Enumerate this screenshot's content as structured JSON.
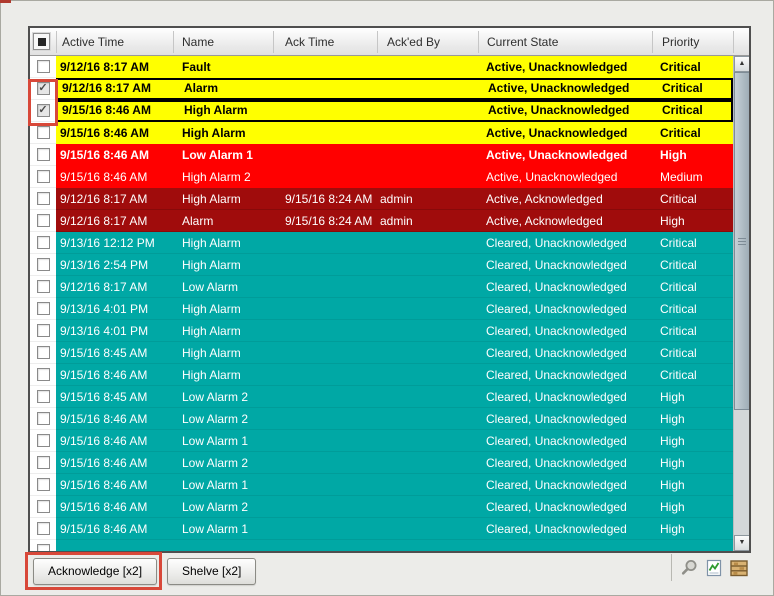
{
  "table": {
    "columns": [
      "Active Time",
      "Name",
      "Ack Time",
      "Ack'ed By",
      "Current State",
      "Priority"
    ],
    "rows": [
      {
        "active_time": "9/12/16 8:17 AM",
        "name": "Fault",
        "ack_time": "",
        "acked_by": "",
        "current_state": "Active, Unacknowledged",
        "priority": "Critical",
        "style": "yellow",
        "bold": true,
        "checked": false,
        "selected": false
      },
      {
        "active_time": "9/12/16 8:17 AM",
        "name": "Alarm",
        "ack_time": "",
        "acked_by": "",
        "current_state": "Active, Unacknowledged",
        "priority": "Critical",
        "style": "yellow",
        "bold": true,
        "checked": true,
        "selected": true
      },
      {
        "active_time": "9/15/16 8:46 AM",
        "name": "High Alarm",
        "ack_time": "",
        "acked_by": "",
        "current_state": "Active, Unacknowledged",
        "priority": "Critical",
        "style": "yellow",
        "bold": true,
        "checked": true,
        "selected": true
      },
      {
        "active_time": "9/15/16 8:46 AM",
        "name": "High Alarm",
        "ack_time": "",
        "acked_by": "",
        "current_state": "Active, Unacknowledged",
        "priority": "Critical",
        "style": "yellow",
        "bold": true,
        "checked": false,
        "selected": false
      },
      {
        "active_time": "9/15/16 8:46 AM",
        "name": "Low Alarm 1",
        "ack_time": "",
        "acked_by": "",
        "current_state": "Active, Unacknowledged",
        "priority": "High",
        "style": "red",
        "bold": true,
        "checked": false,
        "selected": false
      },
      {
        "active_time": "9/15/16 8:46 AM",
        "name": "High Alarm 2",
        "ack_time": "",
        "acked_by": "",
        "current_state": "Active, Unacknowledged",
        "priority": "Medium",
        "style": "red",
        "bold": false,
        "checked": false,
        "selected": false
      },
      {
        "active_time": "9/12/16 8:17 AM",
        "name": "High Alarm",
        "ack_time": "9/15/16 8:24 AM",
        "acked_by": "admin",
        "current_state": "Active, Acknowledged",
        "priority": "Critical",
        "style": "darkred",
        "bold": false,
        "checked": false,
        "selected": false
      },
      {
        "active_time": "9/12/16 8:17 AM",
        "name": "Alarm",
        "ack_time": "9/15/16 8:24 AM",
        "acked_by": "admin",
        "current_state": "Active, Acknowledged",
        "priority": "High",
        "style": "darkred",
        "bold": false,
        "checked": false,
        "selected": false
      },
      {
        "active_time": "9/13/16 12:12 PM",
        "name": "High Alarm",
        "ack_time": "",
        "acked_by": "",
        "current_state": "Cleared, Unacknowledged",
        "priority": "Critical",
        "style": "teal",
        "bold": false,
        "checked": false,
        "selected": false
      },
      {
        "active_time": "9/13/16 2:54 PM",
        "name": "High Alarm",
        "ack_time": "",
        "acked_by": "",
        "current_state": "Cleared, Unacknowledged",
        "priority": "Critical",
        "style": "teal",
        "bold": false,
        "checked": false,
        "selected": false
      },
      {
        "active_time": "9/12/16 8:17 AM",
        "name": "Low Alarm",
        "ack_time": "",
        "acked_by": "",
        "current_state": "Cleared, Unacknowledged",
        "priority": "Critical",
        "style": "teal",
        "bold": false,
        "checked": false,
        "selected": false
      },
      {
        "active_time": "9/13/16 4:01 PM",
        "name": "High Alarm",
        "ack_time": "",
        "acked_by": "",
        "current_state": "Cleared, Unacknowledged",
        "priority": "Critical",
        "style": "teal",
        "bold": false,
        "checked": false,
        "selected": false
      },
      {
        "active_time": "9/13/16 4:01 PM",
        "name": "High Alarm",
        "ack_time": "",
        "acked_by": "",
        "current_state": "Cleared, Unacknowledged",
        "priority": "Critical",
        "style": "teal",
        "bold": false,
        "checked": false,
        "selected": false
      },
      {
        "active_time": "9/15/16 8:45 AM",
        "name": "High Alarm",
        "ack_time": "",
        "acked_by": "",
        "current_state": "Cleared, Unacknowledged",
        "priority": "Critical",
        "style": "teal",
        "bold": false,
        "checked": false,
        "selected": false
      },
      {
        "active_time": "9/15/16 8:46 AM",
        "name": "High Alarm",
        "ack_time": "",
        "acked_by": "",
        "current_state": "Cleared, Unacknowledged",
        "priority": "Critical",
        "style": "teal",
        "bold": false,
        "checked": false,
        "selected": false
      },
      {
        "active_time": "9/15/16 8:45 AM",
        "name": "Low Alarm 2",
        "ack_time": "",
        "acked_by": "",
        "current_state": "Cleared, Unacknowledged",
        "priority": "High",
        "style": "teal",
        "bold": false,
        "checked": false,
        "selected": false
      },
      {
        "active_time": "9/15/16 8:46 AM",
        "name": "Low Alarm 2",
        "ack_time": "",
        "acked_by": "",
        "current_state": "Cleared, Unacknowledged",
        "priority": "High",
        "style": "teal",
        "bold": false,
        "checked": false,
        "selected": false
      },
      {
        "active_time": "9/15/16 8:46 AM",
        "name": "Low Alarm 1",
        "ack_time": "",
        "acked_by": "",
        "current_state": "Cleared, Unacknowledged",
        "priority": "High",
        "style": "teal",
        "bold": false,
        "checked": false,
        "selected": false
      },
      {
        "active_time": "9/15/16 8:46 AM",
        "name": "Low Alarm 2",
        "ack_time": "",
        "acked_by": "",
        "current_state": "Cleared, Unacknowledged",
        "priority": "High",
        "style": "teal",
        "bold": false,
        "checked": false,
        "selected": false
      },
      {
        "active_time": "9/15/16 8:46 AM",
        "name": "Low Alarm 1",
        "ack_time": "",
        "acked_by": "",
        "current_state": "Cleared, Unacknowledged",
        "priority": "High",
        "style": "teal",
        "bold": false,
        "checked": false,
        "selected": false
      },
      {
        "active_time": "9/15/16 8:46 AM",
        "name": "Low Alarm 2",
        "ack_time": "",
        "acked_by": "",
        "current_state": "Cleared, Unacknowledged",
        "priority": "High",
        "style": "teal",
        "bold": false,
        "checked": false,
        "selected": false
      },
      {
        "active_time": "9/15/16 8:46 AM",
        "name": "Low Alarm 1",
        "ack_time": "",
        "acked_by": "",
        "current_state": "Cleared, Unacknowledged",
        "priority": "High",
        "style": "teal",
        "bold": false,
        "checked": false,
        "selected": false
      }
    ],
    "partial_row": {
      "style": "teal"
    }
  },
  "footer": {
    "acknowledge_label": "Acknowledge [x2]",
    "shelve_label": "Shelve [x2]"
  },
  "icons": [
    "search-icon",
    "excel-export-icon",
    "shelf-icon"
  ],
  "colors": {
    "active_unack_blink": "#FFFF00",
    "active_unack": "#FF0000",
    "active_ack": "#A00C0C",
    "cleared_unack": "#00A8A5",
    "annotation": "#D84839",
    "selection_border": "#000000"
  }
}
